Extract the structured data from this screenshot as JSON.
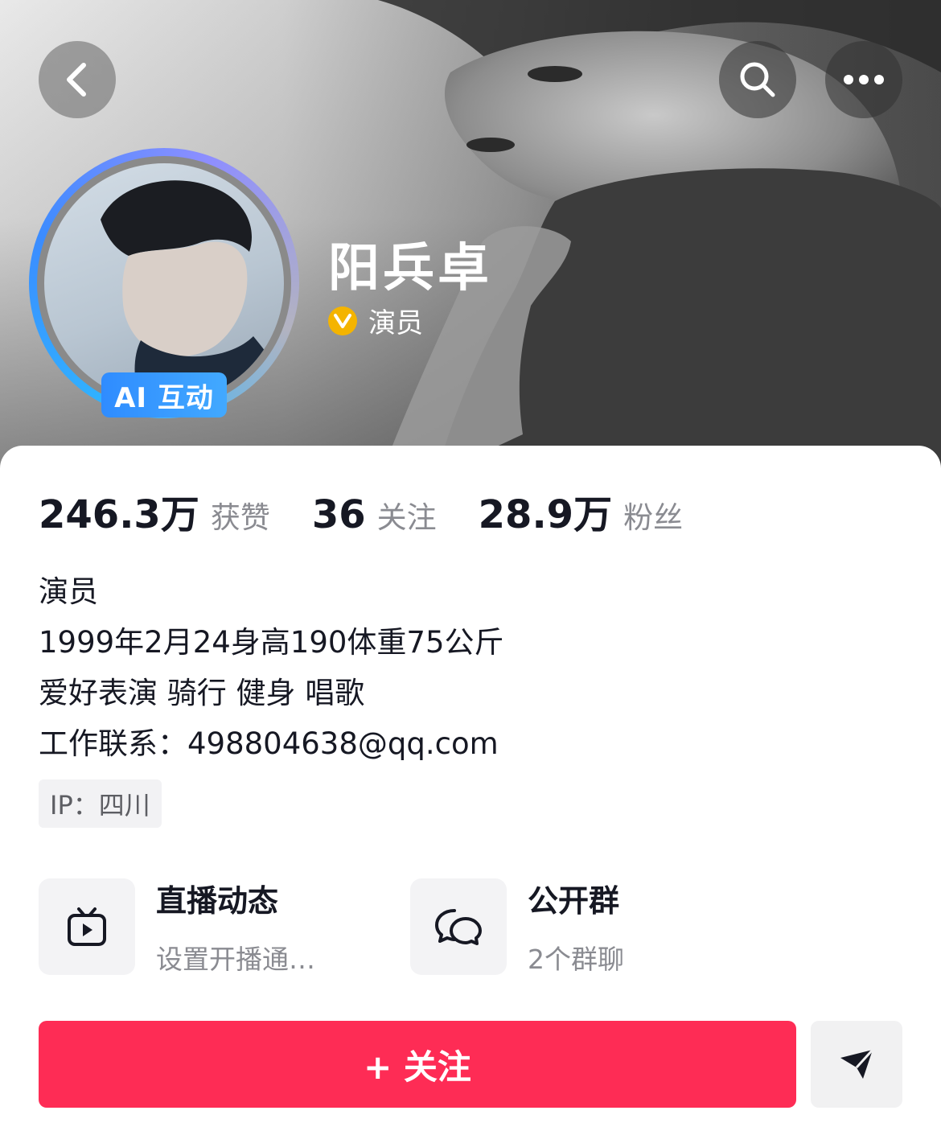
{
  "header": {
    "profile_name": "阳兵卓",
    "verification_label": "演员",
    "avatar_badge": "AI 互动",
    "icons": {
      "back": "chevron-left-icon",
      "search": "search-icon",
      "more": "more-horizontal-icon",
      "verify": "verified-v-icon"
    }
  },
  "stats": [
    {
      "value": "246.3万",
      "label": "获赞"
    },
    {
      "value": "36",
      "label": "关注"
    },
    {
      "value": "28.9万",
      "label": "粉丝"
    }
  ],
  "bio": {
    "lines": [
      "演员",
      "1999年2月24身高190体重75公斤",
      "爱好表演 骑行 健身 唱歌",
      "工作联系：498804638@qq.com"
    ],
    "ip_location": "IP：四川"
  },
  "features": [
    {
      "title": "直播动态",
      "subtitle": "设置开播通…",
      "icon": "tv-play-icon"
    },
    {
      "title": "公开群",
      "subtitle": "2个群聊",
      "icon": "chat-bubbles-icon"
    }
  ],
  "actions": {
    "follow_label": "+ 关注",
    "share_icon": "send-icon"
  },
  "colors": {
    "follow_button": "#fe2c55",
    "verify_badge": "#f4b400",
    "ai_badge": "#2f8cff"
  }
}
